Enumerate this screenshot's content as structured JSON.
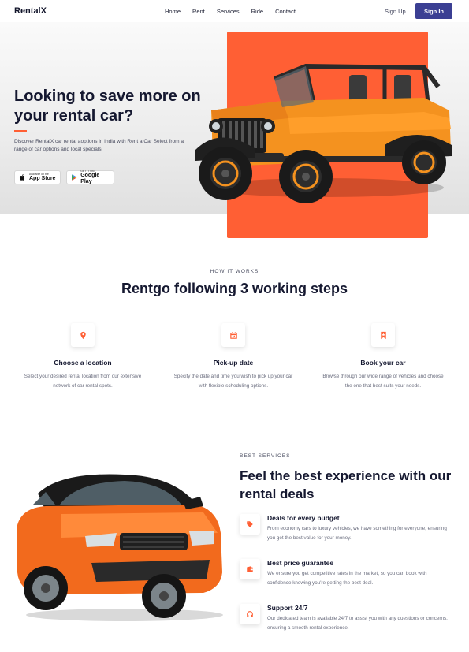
{
  "nav": {
    "logo": "RentalX",
    "links": [
      "Home",
      "Rent",
      "Services",
      "Ride",
      "Contact"
    ],
    "signup": "Sign Up",
    "signin": "Sign In"
  },
  "hero": {
    "title": "Looking to save more on your rental car?",
    "description": "Discover RentalX car rental aoptions in India with Rent a Car Select from a range of car options and local specials.",
    "appstore": {
      "small": "Available on the",
      "big": "App Store",
      "icon": "apple-icon"
    },
    "googleplay": {
      "small": "GET IT ON",
      "big": "Google Play",
      "icon": "google-play-icon"
    },
    "accent_color": "#ff5f34"
  },
  "how_it_works": {
    "kicker": "HOW IT WORKS",
    "title": "Rentgo following 3 working steps",
    "steps": [
      {
        "icon": "location-pin-icon",
        "title": "Choose a location",
        "desc": "Select your desired rental location from our extensive network of car rental spots."
      },
      {
        "icon": "calendar-check-icon",
        "title": "Pick-up date",
        "desc": "Specify the date and time you wish to pick up your car with flexible scheduling options."
      },
      {
        "icon": "bookmark-star-icon",
        "title": "Book your car",
        "desc": "Browse through our wide range of vehicles and choose the one that best suits your needs."
      }
    ]
  },
  "best_services": {
    "kicker": "BEST SERVICES",
    "title": "Feel the best experience with our rental deals",
    "features": [
      {
        "icon": "tag-icon",
        "title": "Deals for every budget",
        "desc": "From economy cars to luxury vehicles, we have something for everyone, ensuring you get the best value for your money."
      },
      {
        "icon": "wallet-icon",
        "title": "Best price guarantee",
        "desc": "We ensure you get competitive rates in the market, so you can book with confidence knowing you're getting the best deal."
      },
      {
        "icon": "headphones-icon",
        "title": "Support 24/7",
        "desc": "Our dedicated team is available 24/7 to assist you with any questions or concerns, ensuring a smooth rental experience."
      }
    ]
  },
  "colors": {
    "brand": "#3b3f93",
    "accent": "#ff5f34",
    "heading": "#151830"
  }
}
